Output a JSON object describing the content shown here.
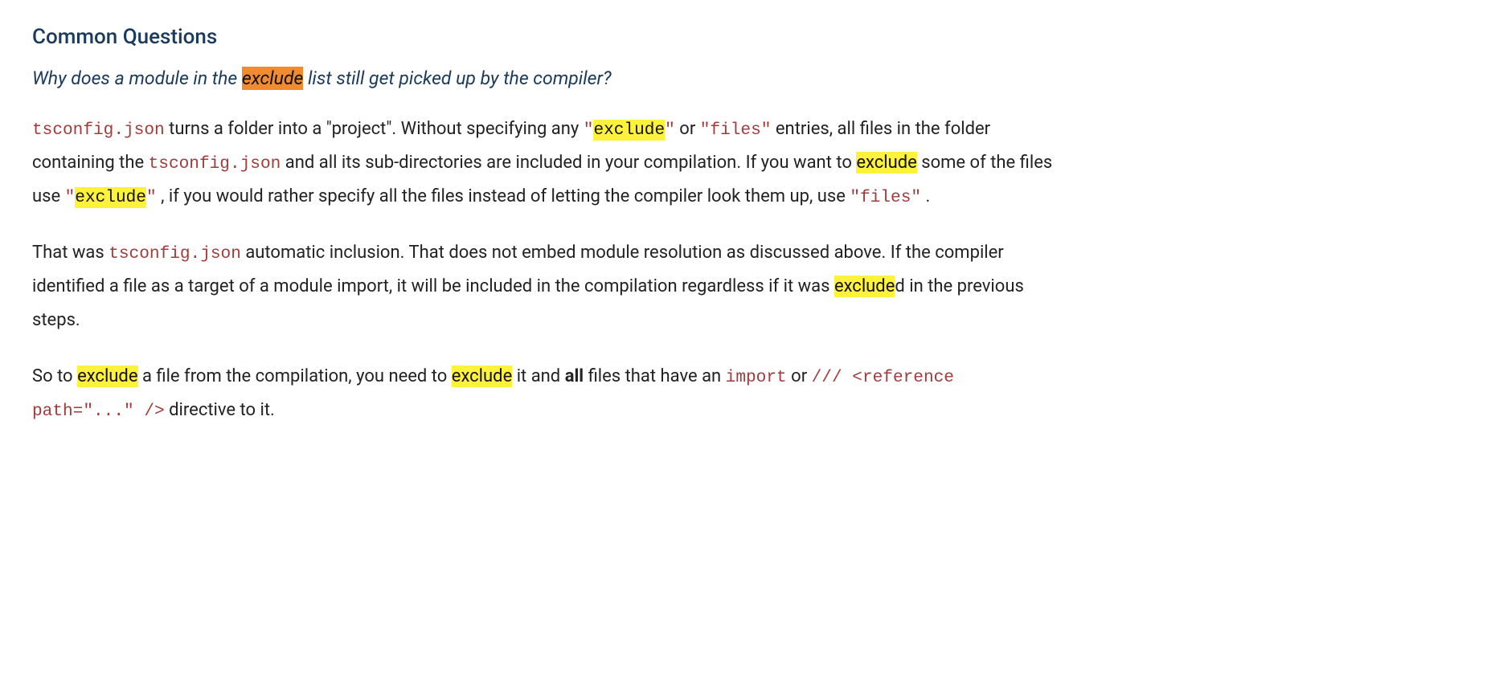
{
  "section_heading": "Common Questions",
  "question": {
    "pre": "Why does a module in the ",
    "hl": "exclude",
    "post": " list still get picked up by the compiler?"
  },
  "p1": {
    "c1": "tsconfig.json",
    "t1": " turns a folder into a \"project\". Without specifying any ",
    "c2a": "\"",
    "c2hl": "exclude",
    "c2b": "\"",
    "t2": " or ",
    "c3": "\"files\"",
    "t3": " entries, all files in the folder containing the ",
    "c4": "tsconfig.json",
    "t4": " and all its sub-directories are included in your compilation. If you want to ",
    "hl1": "exclude",
    "t5": " some of the files use ",
    "c5a": "\"",
    "c5hl": "exclude",
    "c5b": "\"",
    "t6": " , if you would rather specify all the files instead of letting the compiler look them up, use ",
    "c6": "\"files\"",
    "t7": " ."
  },
  "p2": {
    "t1": "That was ",
    "c1": "tsconfig.json",
    "t2": " automatic inclusion. That does not embed module resolution as discussed above. If the compiler identified a file as a target of a module import, it will be included in the compilation regardless if it was ",
    "hl1": "exclude",
    "t3": "d in the previous steps."
  },
  "p3": {
    "t1": "So to ",
    "hl1": "exclude",
    "t2": " a file from the compilation, you need to ",
    "hl2": "exclude",
    "t3": " it and ",
    "b1": "all",
    "t4": " files that have an ",
    "c1": "import",
    "t5": " or ",
    "c2": "/// <reference path=\"...\" />",
    "t6": " directive to it."
  }
}
